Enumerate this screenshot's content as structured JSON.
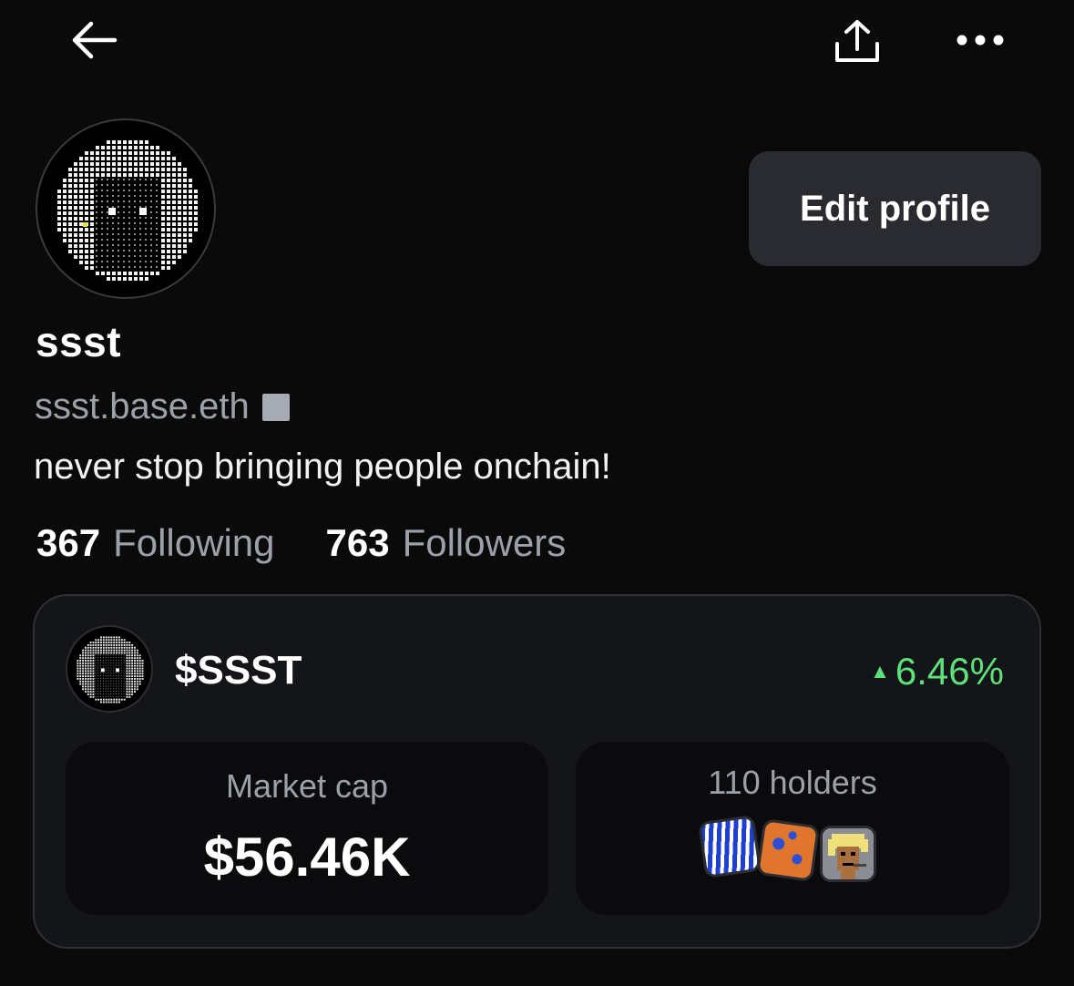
{
  "header": {
    "back_icon": "arrow-left-icon",
    "share_icon": "share-upload-icon",
    "more_icon": "more-horizontal-icon"
  },
  "profile": {
    "avatar_icon": "pixel-art-avatar",
    "edit_label": "Edit profile",
    "name": "ssst",
    "handle": "ssst.base.eth",
    "handle_badge_icon": "square-badge-icon",
    "bio": "never stop bringing people onchain!",
    "following_count": "367",
    "following_label": "Following",
    "followers_count": "763",
    "followers_label": "Followers"
  },
  "token": {
    "symbol": "$SSST",
    "change": "6.46%",
    "change_icon": "triangle-up-icon",
    "market_cap_label": "Market cap",
    "market_cap_value": "$56.46K",
    "holders_label": "110 holders"
  },
  "colors": {
    "background": "#0a0a0b",
    "card": "#141519",
    "inner_card": "#0b0b0d",
    "button": "#2a2b30",
    "muted_text": "#9ca0a8",
    "positive": "#5fe07a"
  }
}
